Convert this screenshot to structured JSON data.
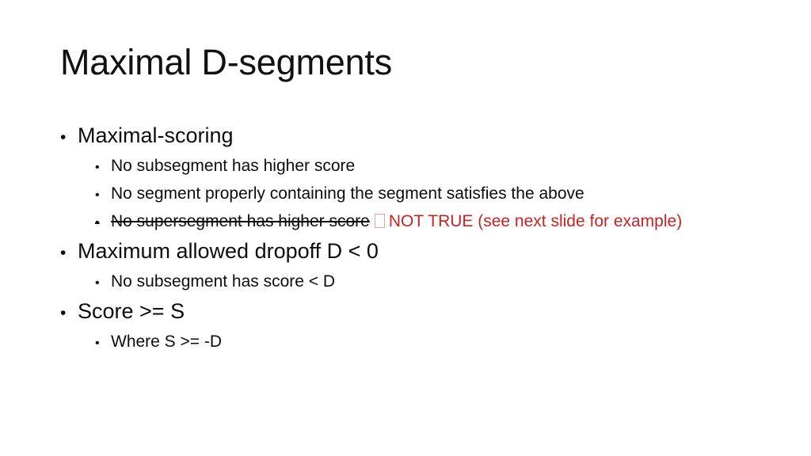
{
  "slide": {
    "title": "Maximal D-segments",
    "background_color": "#ffffff",
    "text_color": "#0d0d0d",
    "accent_red": "#c32424",
    "bullet_glyph": "•",
    "items": [
      {
        "level": 1,
        "text": "Maximal-scoring"
      },
      {
        "level": 2,
        "text": "No subsegment has higher score"
      },
      {
        "level": 2,
        "text": "No segment properly containing the segment satisfies the above"
      },
      {
        "level": 2,
        "text": "No supersegment has higher score",
        "strikethrough": true,
        "annotation": "NOT TRUE (see next slide for example)",
        "annotation_color": "#c32424",
        "missing_glyph_box": true
      },
      {
        "level": 1,
        "text": "Maximum allowed dropoff D < 0"
      },
      {
        "level": 2,
        "text": "No subsegment has score < D"
      },
      {
        "level": 1,
        "text": "Score >= S"
      },
      {
        "level": 2,
        "text": "Where S >= -D"
      }
    ]
  }
}
